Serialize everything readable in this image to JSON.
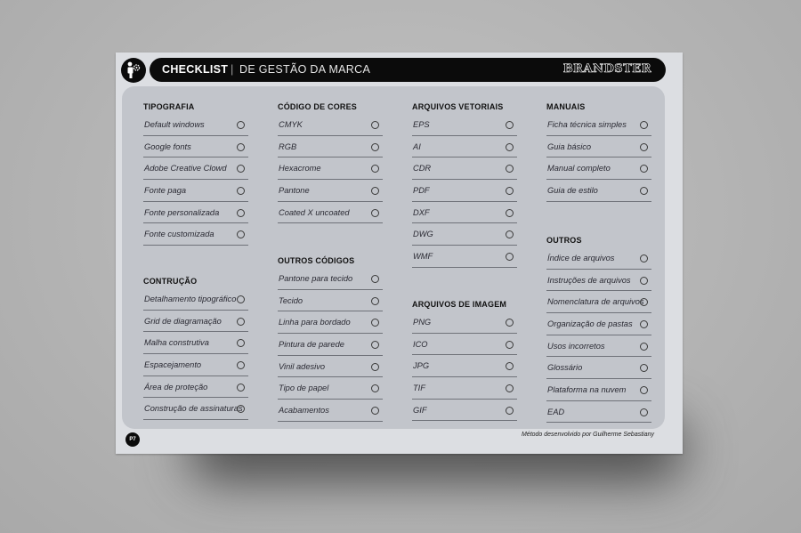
{
  "header": {
    "title": "CHECKLIST",
    "separator": "|",
    "subtitle": "DE GESTÃO DA MARCA",
    "brand": "BRANDSTER",
    "logo_icon": "person-with-gear-icon"
  },
  "columns": [
    {
      "sections": [
        {
          "title": "TIPOGRAFIA",
          "items": [
            "Default windows",
            "Google fonts",
            "Adobe Creative Clowd",
            "Fonte paga",
            "Fonte personalizada",
            "Fonte customizada"
          ]
        },
        {
          "title": "CONTRUÇÃO",
          "items": [
            "Detalhamento tipográfico",
            "Grid de diagramação",
            "Malha construtiva",
            "Espacejamento",
            "Área de proteção",
            "Construção de assinaturas"
          ]
        }
      ]
    },
    {
      "sections": [
        {
          "title": "CÓDIGO DE CORES",
          "items": [
            "CMYK",
            "RGB",
            "Hexacrome",
            "Pantone",
            "Coated X uncoated"
          ]
        },
        {
          "title": "OUTROS CÓDIGOS",
          "items": [
            "Pantone para tecido",
            "Tecido",
            "Linha para bordado",
            "Pintura de parede",
            "Vinil adesivo",
            "Tipo de papel",
            "Acabamentos"
          ]
        }
      ]
    },
    {
      "sections": [
        {
          "title": "ARQUIVOS VETORIAIS",
          "items": [
            "EPS",
            "AI",
            "CDR",
            "PDF",
            "DXF",
            "DWG",
            "WMF"
          ]
        },
        {
          "title": "ARQUIVOS DE IMAGEM",
          "items": [
            "PNG",
            "ICO",
            "JPG",
            "TIF",
            "GIF"
          ]
        }
      ]
    },
    {
      "sections": [
        {
          "title": "MANUAIS",
          "items": [
            "Ficha técnica simples",
            "Guia básico",
            "Manual completo",
            "Guia de estilo"
          ]
        },
        {
          "title": "OUTROS",
          "items": [
            "Índice de arquivos",
            "Instruções de arquivos",
            "Nomenclatura de arquivos",
            "Organização de pastas",
            "Usos incorretos",
            "Glossário",
            "Plataforma na nuvem",
            "EAD"
          ]
        }
      ]
    }
  ],
  "footer": {
    "page_number": "P7",
    "credit": "Método desenvolvido por Guilherme Sebastiany"
  }
}
